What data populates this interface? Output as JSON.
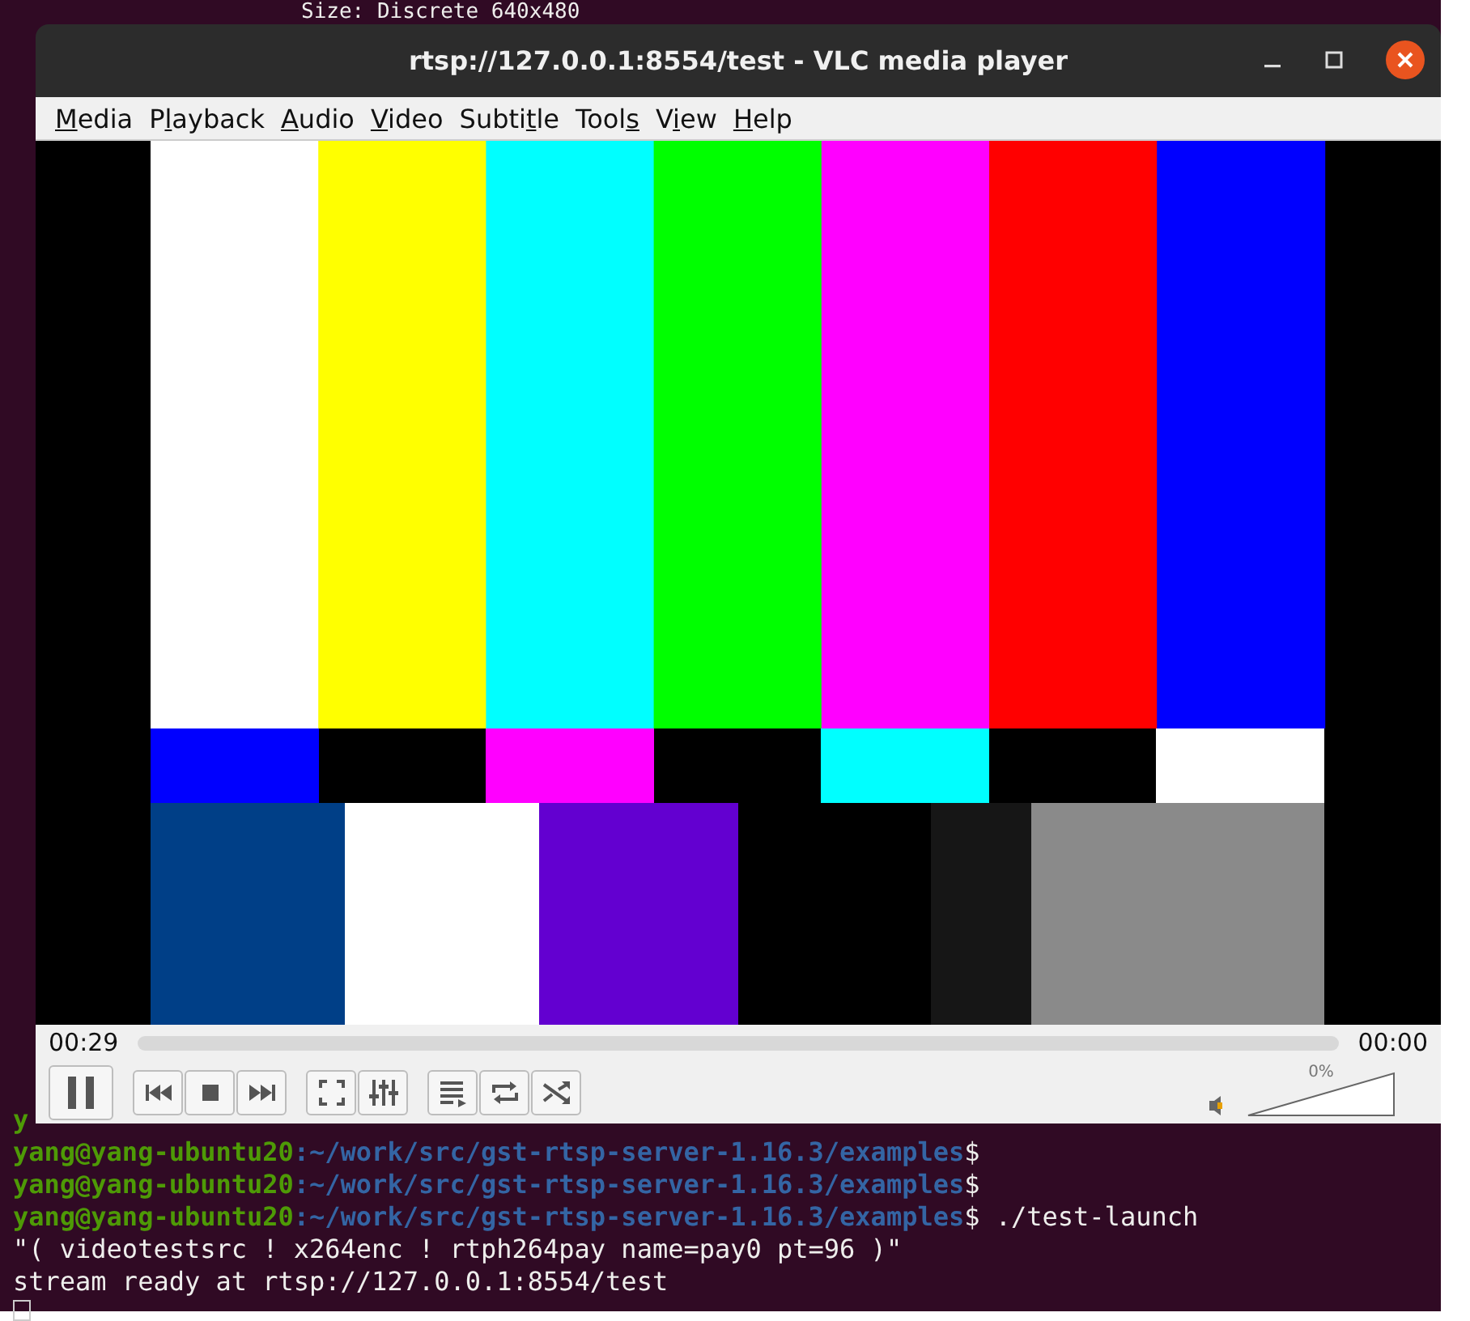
{
  "terminal": {
    "top_line": "Size: Discrete 640x480",
    "lines": [
      {
        "kind": "text",
        "segments": [
          {
            "kind": "user",
            "text": "y"
          }
        ]
      },
      {
        "kind": "text",
        "segments": [
          {
            "kind": "user",
            "text": "yang@yang-ubuntu20"
          },
          {
            "kind": "path",
            "text": ":~/work/src/gst-rtsp-server-1.16.3/examples"
          },
          {
            "kind": "text",
            "text": "$"
          }
        ]
      },
      {
        "kind": "text",
        "segments": [
          {
            "kind": "user",
            "text": "yang@yang-ubuntu20"
          },
          {
            "kind": "path",
            "text": ":~/work/src/gst-rtsp-server-1.16.3/examples"
          },
          {
            "kind": "text",
            "text": "$"
          }
        ]
      },
      {
        "kind": "text",
        "segments": [
          {
            "kind": "user",
            "text": "yang@yang-ubuntu20"
          },
          {
            "kind": "path",
            "text": ":~/work/src/gst-rtsp-server-1.16.3/examples"
          },
          {
            "kind": "text",
            "text": "$ ./test-launch"
          }
        ]
      },
      {
        "kind": "text",
        "segments": [
          {
            "kind": "text",
            "text": "\"( videotestsrc ! x264enc ! rtph264pay name=pay0 pt=96 )\""
          }
        ]
      },
      {
        "kind": "text",
        "segments": [
          {
            "kind": "text",
            "text": "stream ready at rtsp://127.0.0.1:8554/test"
          }
        ]
      },
      {
        "kind": "cursor"
      }
    ]
  },
  "window": {
    "title": "rtsp://127.0.0.1:8554/test - VLC media player"
  },
  "menu": [
    {
      "key": "M",
      "after": "edia"
    },
    {
      "before": "P",
      "key": "l",
      "after": "ayback"
    },
    {
      "key": "A",
      "after": "udio"
    },
    {
      "key": "V",
      "after": "ideo"
    },
    {
      "before": "Subti",
      "key": "t",
      "after": "le"
    },
    {
      "before": "Tool",
      "key": "s"
    },
    {
      "before": "V",
      "key": "i",
      "after": "ew"
    },
    {
      "key": "H",
      "after": "elp"
    }
  ],
  "seek": {
    "elapsed": "00:29",
    "total": "00:00"
  },
  "controls": [
    {
      "kind": "pause"
    },
    {
      "kind": "previous"
    },
    {
      "kind": "stop"
    },
    {
      "kind": "next"
    },
    {
      "kind": "fullscreen"
    },
    {
      "kind": "settings"
    },
    {
      "kind": "playlist"
    },
    {
      "kind": "loop"
    },
    {
      "kind": "shuffle"
    }
  ],
  "volume": {
    "reading": "0%"
  }
}
